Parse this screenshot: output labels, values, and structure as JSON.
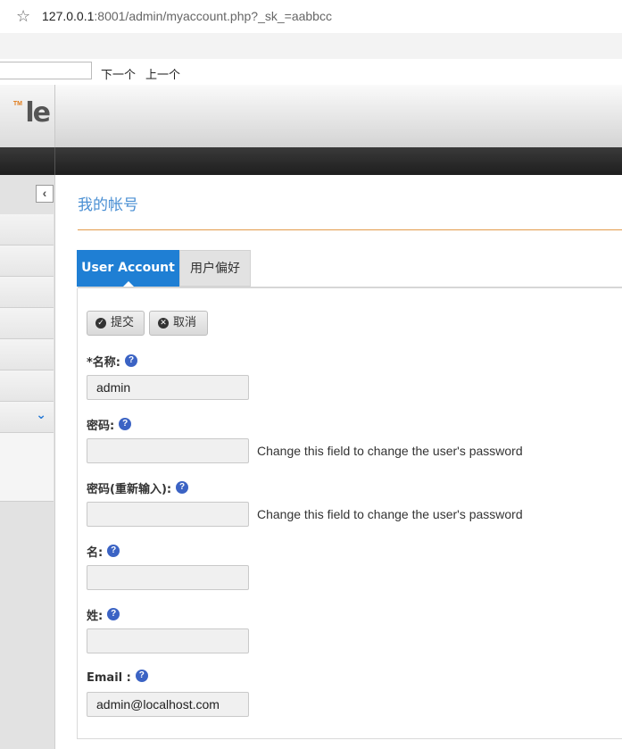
{
  "browser": {
    "url_host": "127.0.0.1",
    "url_rest": ":8001/admin/myaccount.php?_sk_=aabbcc"
  },
  "findbar": {
    "next_label": "下一个",
    "prev_label": "上一个",
    "value": ""
  },
  "logo": {
    "text": "le",
    "tm": "TM"
  },
  "page": {
    "title": "我的帐号"
  },
  "tabs": [
    {
      "label": "User Account",
      "active": true
    },
    {
      "label": "用户偏好",
      "active": false
    }
  ],
  "actions": {
    "submit_label": "提交",
    "cancel_label": "取消"
  },
  "fields": {
    "name": {
      "label": "*名称:",
      "value": "admin"
    },
    "password": {
      "label": "密码:",
      "value": "",
      "note": "Change this field to change the user's password"
    },
    "password_confirm": {
      "label": "密码(重新输入):",
      "value": "",
      "note": "Change this field to change the user's password"
    },
    "first_name": {
      "label": "名:",
      "value": ""
    },
    "last_name": {
      "label": "姓:",
      "value": ""
    },
    "email": {
      "label": "Email :",
      "value": "admin@localhost.com"
    }
  },
  "help_glyph": "?",
  "colors": {
    "accent_blue": "#1f7fd4",
    "title_blue": "#4a8fd3",
    "rule_orange": "#e39a4a",
    "help_blue": "#3b63c4"
  }
}
